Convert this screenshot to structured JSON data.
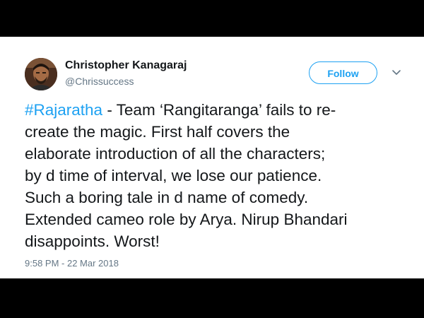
{
  "author": {
    "name": "Christopher Kanagaraj",
    "handle": "@Chrissuccess"
  },
  "header": {
    "follow_label": "Follow",
    "menu_icon": "chevron-down-icon"
  },
  "tweet": {
    "hashtag": "#Rajaratha",
    "text_line_1": " - Team ‘Rangitaranga’ fails to re-",
    "text_line_2": "create the magic. First half covers the",
    "text_line_3": "elaborate introduction of all the characters;",
    "text_line_4": "by d time of interval, we lose our patience.",
    "text_line_5": "Such a boring tale in d name of comedy.",
    "text_line_6": "Extended cameo role by Arya. Nirup Bhandari",
    "text_line_7": "disappoints. Worst!",
    "timestamp": "9:58 PM - 22 Mar 2018"
  },
  "colors": {
    "accent": "#1da1f2",
    "text": "#14171a",
    "muted": "#657786",
    "letterbox": "#000000"
  }
}
